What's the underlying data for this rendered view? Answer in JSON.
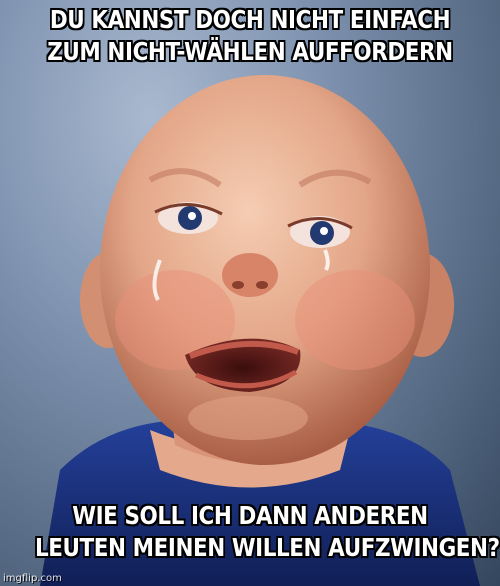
{
  "meme": {
    "top_text": {
      "line1": "DU KANNST DOCH NICHT EINFACH",
      "line2": "ZUM NICHT-WÄHLEN AUFFORDERN"
    },
    "bottom_text": {
      "line1": "WIE SOLL ICH DANN ANDEREN",
      "line2": "LEUTEN MEINEN WILLEN AUFZWINGEN?"
    },
    "watermark": "imgflip.com"
  },
  "colors": {
    "background": "#5a6f8a",
    "skin": "#e8a88a",
    "shirt": "#1b2f7a",
    "caption_fill": "#ffffff",
    "caption_outline": "#000000"
  }
}
